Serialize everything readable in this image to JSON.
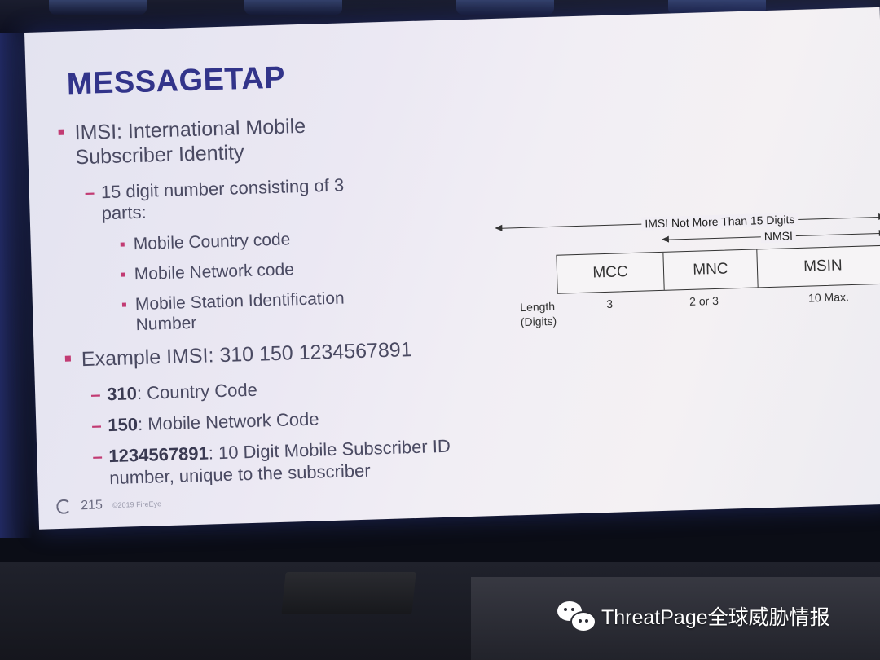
{
  "slide": {
    "title": "MESSAGETAP",
    "bullets": {
      "imsi_line1": "IMSI: International Mobile",
      "imsi_line2": "Subscriber Identity",
      "digits_line1": "15 digit number consisting of 3",
      "digits_line2": "parts:",
      "part1": "Mobile Country code",
      "part2": "Mobile Network code",
      "part3_line1": "Mobile Station Identification",
      "part3_line2": "Number",
      "example": "Example IMSI: 310 150 1234567891",
      "ex1_bold": "310",
      "ex1_rest": ": Country Code",
      "ex2_bold": "150",
      "ex2_rest": ": Mobile Network Code",
      "ex3_bold": "1234567891",
      "ex3_rest": ": 10 Digit Mobile Subscriber ID",
      "ex3_line2": "number, unique to the subscriber"
    },
    "footer": {
      "page_number": "215",
      "copyright": "©2019 FireEye"
    }
  },
  "diagram": {
    "imsi_arrow_label": "IMSI Not More Than 15 Digits",
    "nmsi_arrow_label": "NMSI",
    "cells": [
      "MCC",
      "MNC",
      "MSIN"
    ],
    "length_label_line1": "Length",
    "length_label_line2": "(Digits)",
    "lengths": [
      "3",
      "2 or 3",
      "10 Max."
    ]
  },
  "watermark": {
    "text": "ThreatPage全球威胁情报",
    "icon": "wechat-icon"
  },
  "colors": {
    "title": "#32348a",
    "bullet_accent": "#c23b73",
    "body_text": "#4a4a62"
  }
}
